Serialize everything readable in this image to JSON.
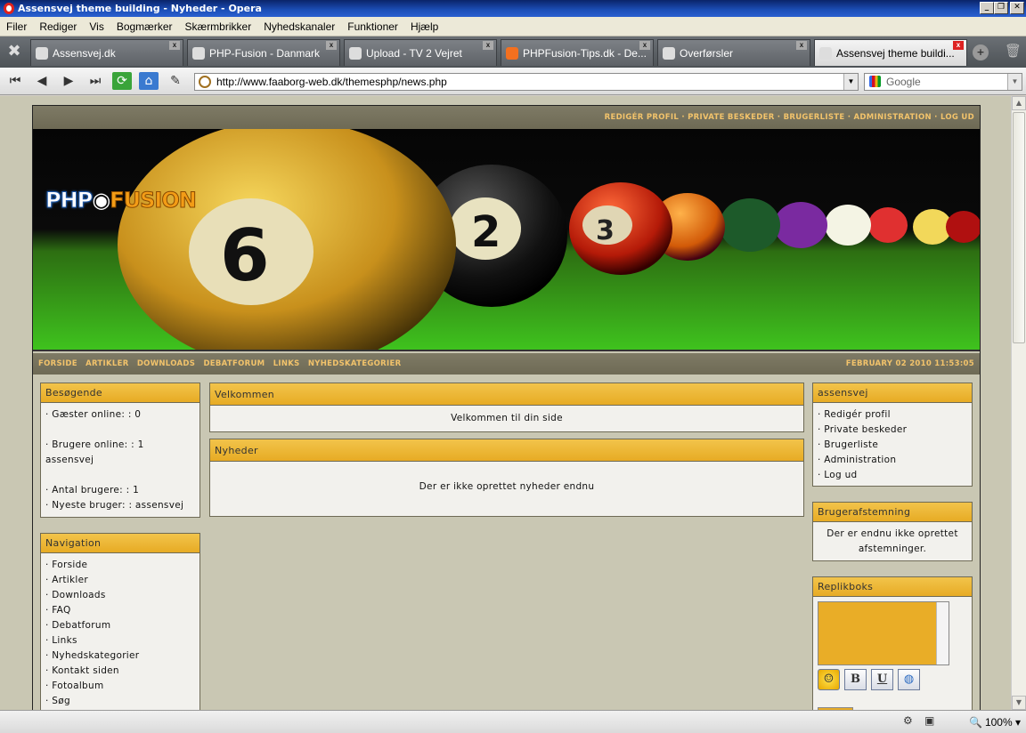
{
  "window": {
    "title": "Assensvej theme building - Nyheder - Opera"
  },
  "menu": [
    "Filer",
    "Rediger",
    "Vis",
    "Bogmærker",
    "Skærmbrikker",
    "Nyhedskanaler",
    "Funktioner",
    "Hjælp"
  ],
  "tabs": [
    {
      "label": "Assensvej.dk"
    },
    {
      "label": "PHP-Fusion - Danmark"
    },
    {
      "label": "Upload - TV 2 Vejret"
    },
    {
      "label": "PHPFusion-Tips.dk - De..."
    },
    {
      "label": "Overførsler"
    },
    {
      "label": "Assensvej theme buildi..."
    }
  ],
  "address": {
    "url": "http://www.faaborg-web.dk/themesphp/news.php",
    "search_placeholder": "Google"
  },
  "status": {
    "zoom": "100%"
  },
  "site": {
    "topbar": "REDIGÉR PROFIL · PRIVATE BESKEDER · BRUGERLISTE · ADMINISTRATION · LOG UD",
    "logo_left": "PHP",
    "logo_right": "FUSION",
    "nav": [
      "FORSIDE",
      "ARTIKLER",
      "DOWNLOADS",
      "DEBATFORUM",
      "LINKS",
      "NYHEDSKATEGORIER"
    ],
    "date": "FEBRUARY 02 2010 11:53:05",
    "besogende": {
      "title": "Besøgende",
      "guests": "· Gæster online: : 0",
      "users": "· Brugere online: : 1",
      "user_name": "assensvej",
      "count": "· Antal brugere: : 1",
      "newest": "· Nyeste bruger: : assensvej"
    },
    "navigation": {
      "title": "Navigation",
      "items": [
        "· Forside",
        "· Artikler",
        "· Downloads",
        "· FAQ",
        "· Debatforum",
        "· Links",
        "· Nyhedskategorier",
        "· Kontakt siden",
        "· Fotoalbum",
        "· Søg"
      ]
    },
    "welcome": {
      "title": "Velkommen",
      "text": "Velkommen til din side"
    },
    "news": {
      "title": "Nyheder",
      "text": "Der er ikke oprettet nyheder endnu"
    },
    "user": {
      "title": "assensvej",
      "items": [
        "· Redigér profil",
        "· Private beskeder",
        "· Brugerliste",
        "· Administration",
        "· Log ud"
      ]
    },
    "poll": {
      "title": "Brugerafstemning",
      "line1": "Der er endnu ikke oprettet",
      "line2": "afstemninger."
    },
    "shoutbox": {
      "title": "Replikboks",
      "bold": "B",
      "underline": "U"
    }
  }
}
